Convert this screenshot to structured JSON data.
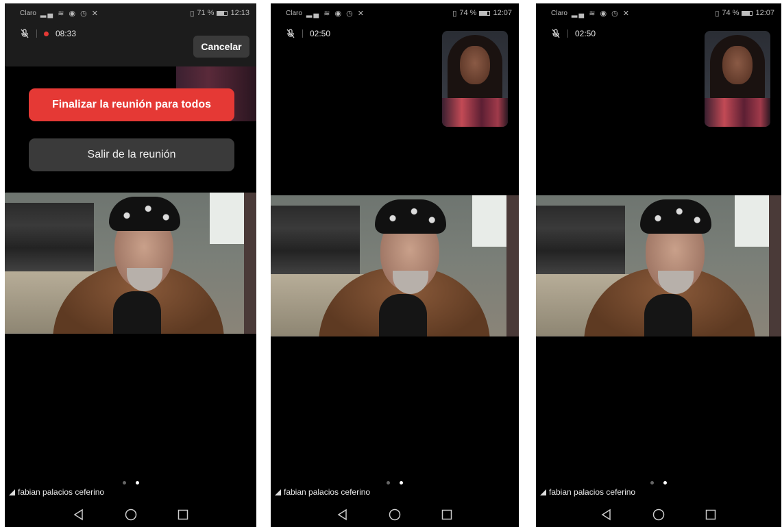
{
  "screens": [
    {
      "status": {
        "carrier": "Claro",
        "battery_text": "71 %",
        "battery_level": 0.71,
        "time": "12:13"
      },
      "meeting": {
        "timer": "08:33",
        "recording": true
      },
      "overlay": {
        "cancel_label": "Cancelar",
        "end_for_all_label": "Finalizar la reunión para todos",
        "leave_label": "Salir de la reunión"
      },
      "participant_name": "fabian palacios ceferino"
    },
    {
      "status": {
        "carrier": "Claro",
        "battery_text": "74 %",
        "battery_level": 0.74,
        "time": "12:07"
      },
      "meeting": {
        "timer": "02:50",
        "recording": false
      },
      "participant_name": "fabian palacios ceferino"
    },
    {
      "status": {
        "carrier": "Claro",
        "battery_text": "74 %",
        "battery_level": 0.74,
        "time": "12:07"
      },
      "meeting": {
        "timer": "02:50",
        "recording": false
      },
      "participant_name": "fabian palacios ceferino"
    }
  ],
  "colors": {
    "danger": "#e53935",
    "button_dark": "#3a3a3a"
  },
  "icons": [
    "signal-icon",
    "wifi-icon",
    "mic-muted-icon",
    "back-icon",
    "home-icon",
    "recents-icon"
  ]
}
